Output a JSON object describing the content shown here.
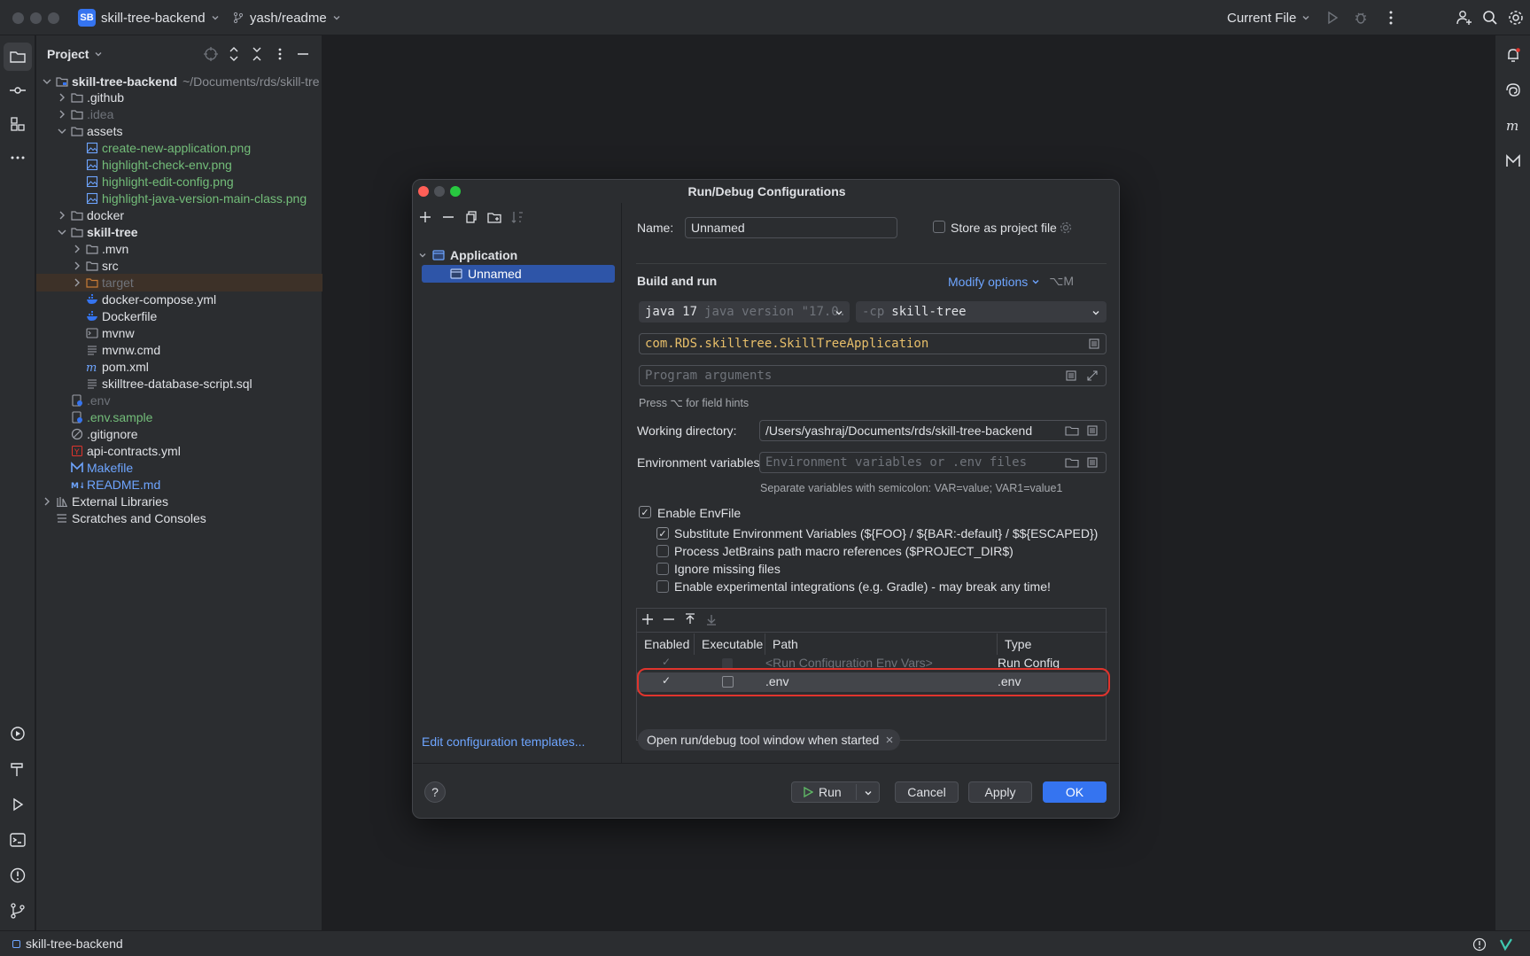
{
  "titlebar": {
    "project_badge": "SB",
    "project_name": "skill-tree-backend",
    "branch": "yash/readme",
    "run_config": "Current File"
  },
  "project_panel": {
    "title": "Project",
    "root": {
      "name": "skill-tree-backend",
      "path": "~/Documents/rds/skill-tre"
    },
    "items": [
      {
        "label": ".github",
        "kind": "folder"
      },
      {
        "label": ".idea",
        "kind": "folder"
      },
      {
        "label": "assets",
        "kind": "folder"
      },
      {
        "label": "create-new-application.png",
        "kind": "image"
      },
      {
        "label": "highlight-check-env.png",
        "kind": "image"
      },
      {
        "label": "highlight-edit-config.png",
        "kind": "image"
      },
      {
        "label": "highlight-java-version-main-class.png",
        "kind": "image"
      },
      {
        "label": "docker",
        "kind": "folder"
      },
      {
        "label": "skill-tree",
        "kind": "folder"
      },
      {
        "label": ".mvn",
        "kind": "folder"
      },
      {
        "label": "src",
        "kind": "folder"
      },
      {
        "label": "target",
        "kind": "folder"
      },
      {
        "label": "docker-compose.yml",
        "kind": "docker"
      },
      {
        "label": "Dockerfile",
        "kind": "docker"
      },
      {
        "label": "mvnw",
        "kind": "shell"
      },
      {
        "label": "mvnw.cmd",
        "kind": "text"
      },
      {
        "label": "pom.xml",
        "kind": "maven"
      },
      {
        "label": "skilltree-database-script.sql",
        "kind": "text"
      },
      {
        "label": ".env",
        "kind": "env"
      },
      {
        "label": ".env.sample",
        "kind": "env"
      },
      {
        "label": ".gitignore",
        "kind": "ignore"
      },
      {
        "label": "api-contracts.yml",
        "kind": "yaml"
      },
      {
        "label": "Makefile",
        "kind": "make"
      },
      {
        "label": "README.md",
        "kind": "md"
      },
      {
        "label": "External Libraries",
        "kind": "lib"
      },
      {
        "label": "Scratches and Consoles",
        "kind": "scratch"
      }
    ]
  },
  "dialog": {
    "title": "Run/Debug Configurations",
    "tree": {
      "group": "Application",
      "selected": "Unnamed"
    },
    "edit_templates": "Edit configuration templates...",
    "name_label": "Name:",
    "name_value": "Unnamed",
    "store_as_project": "Store as project file",
    "build_and_run": "Build and run",
    "modify_options": "Modify options",
    "modify_shortcut": "⌥M",
    "jdk": "java 17",
    "jdk_version": "java version \"17.0.",
    "cp_prefix": "-cp",
    "module": "skill-tree",
    "main_class": "com.RDS.skilltree.SkillTreeApplication",
    "program_args_placeholder": "Program arguments",
    "field_hint": "Press ⌥ for field hints",
    "working_dir_label": "Working directory:",
    "working_dir_value": "/Users/yashraj/Documents/rds/skill-tree-backend",
    "env_vars_label": "Environment variables:",
    "env_vars_placeholder": "Environment variables or .env files",
    "env_hint": "Separate variables with semicolon: VAR=value; VAR1=value1",
    "enable_envfile": "Enable EnvFile",
    "options": [
      {
        "label": "Substitute Environment Variables (${FOO} / ${BAR:-default} / $${ESCAPED})",
        "checked": true
      },
      {
        "label": "Process JetBrains path macro references ($PROJECT_DIR$)",
        "checked": false
      },
      {
        "label": "Ignore missing files",
        "checked": false
      },
      {
        "label": "Enable experimental integrations (e.g. Gradle) - may break any time!",
        "checked": false
      }
    ],
    "table": {
      "headers": [
        "Enabled",
        "Executable",
        "Path",
        "Type"
      ],
      "rows": [
        {
          "enabled": "✓",
          "executable": "",
          "path": "<Run Configuration Env Vars>",
          "type": "Run Config"
        },
        {
          "enabled": "✓",
          "executable": "",
          "path": ".env",
          "type": ".env"
        }
      ]
    },
    "tag_chip": "Open run/debug tool window when started",
    "buttons": {
      "help": "?",
      "run": "Run",
      "cancel": "Cancel",
      "apply": "Apply",
      "ok": "OK"
    }
  },
  "statusbar": {
    "project": "skill-tree-backend"
  },
  "colors": {
    "accent": "#3574f0",
    "highlight": "#e0342d",
    "vcs_new": "#73bd79"
  }
}
